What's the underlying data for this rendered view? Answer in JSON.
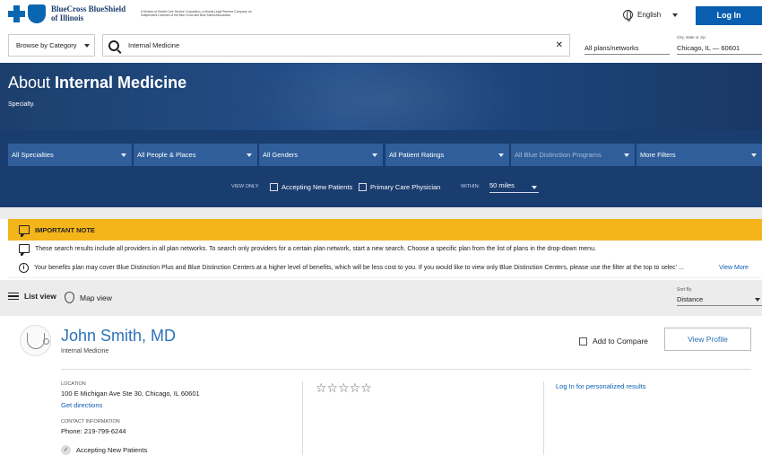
{
  "header": {
    "brand_name_line1": "BlueCross BlueShield",
    "brand_name_line2": "of Illinois",
    "brand_sub": "A Division of Health Care Service Corporation, a Mutual Legal Reserve Company, an Independent Licensee of the Blue Cross and Blue Shield Association",
    "language": "English",
    "login_label": "Log In"
  },
  "search": {
    "browse_label": "Browse by Category",
    "query": "Internal Medicine",
    "clear_icon": "close-icon",
    "plans_value": "All plans/networks",
    "location_label": "City, state or zip",
    "location_value": "Chicago, IL — 60601"
  },
  "hero": {
    "title_prefix": "About ",
    "title_bold": "Internal Medicine",
    "subtitle": "Specialty."
  },
  "filters": {
    "selects": [
      {
        "label": "All Specialties"
      },
      {
        "label": "All People & Places"
      },
      {
        "label": "All Genders"
      },
      {
        "label": "All Patient Ratings"
      },
      {
        "label": "All Blue Distinction Programs"
      },
      {
        "label": "More Filters"
      }
    ],
    "view_only_label": "VIEW ONLY:",
    "accepting_label": "Accepting New Patients",
    "pcp_label": "Primary Care Physician",
    "within_label": "WITHIN:",
    "within_value": "50 miles"
  },
  "notes": {
    "title": "IMPORTANT NOTE",
    "line1": "These search results include all providers in all plan networks. To search only providers for a certain plan network, start a new search. Choose a specific plan from the list of plans in the drop-down menu.",
    "line2": "Your benefits plan may cover Blue Distinction Plus and Blue Distinction Centers at a higher level of benefits, which will be less cost to you. If you would like to view only Blue Distinction Centers, please use the filter at the top to selec’ ...",
    "view_more": "View More"
  },
  "results_bar": {
    "list_view": "List view",
    "map_view": "Map view",
    "sort_label": "Sort By",
    "sort_value": "Distance"
  },
  "provider": {
    "name": "John Smith, MD",
    "specialty": "Internal Medicine",
    "add_compare": "Add to Compare",
    "view_profile": "View Profile",
    "location_label": "LOCATION",
    "address": "100 E Michigan Ave Ste 30, Chicago, IL 60601",
    "directions": "Get directions",
    "contact_label": "CONTACT INFORMATION",
    "phone": "Phone: 219-799-6244",
    "accepting": "Accepting New Patients",
    "rating_stars": "☆☆☆☆☆",
    "login_personalized": "Log In for personalized results"
  },
  "colors": {
    "brand_blue": "#0a5eb0",
    "hero_blue": "#1c3f6d",
    "filter_blue": "#2f5e9b",
    "note_yellow": "#f4b51b"
  }
}
